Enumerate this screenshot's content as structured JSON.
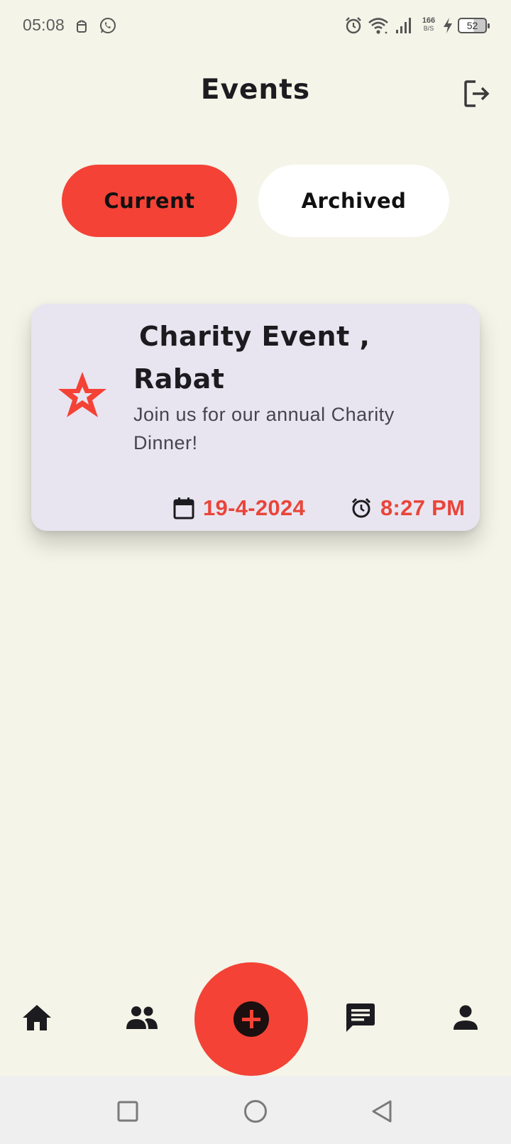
{
  "status_bar": {
    "time": "05:08",
    "net_speed_value": "166",
    "net_speed_unit": "B/S",
    "battery_level": "52",
    "icons": [
      "android-icon",
      "whatsapp-icon",
      "alarm-icon",
      "wifi-icon",
      "signal-icon",
      "charging-icon",
      "battery-icon"
    ]
  },
  "header": {
    "title": "Events",
    "logout_icon": "logout-icon"
  },
  "tabs": [
    {
      "label": "Current",
      "active": true
    },
    {
      "label": "Archived",
      "active": false
    }
  ],
  "events": [
    {
      "title_line1": "Charity Event ,",
      "title_line2": "Rabat",
      "description_line1": "Join us for our annual Charity",
      "description_line2": "Dinner!",
      "date": "19-4-2024",
      "time": "8:27 PM",
      "icon": "star-icon"
    }
  ],
  "bottom_nav": {
    "items": [
      "home-icon",
      "group-icon",
      "add-icon",
      "chat-icon",
      "person-icon"
    ]
  },
  "system_nav": [
    "recents-icon",
    "home-circle-icon",
    "back-icon"
  ],
  "colors": {
    "background": "#f4f4e8",
    "accent": "#f44236",
    "card": "#e8e5f0",
    "accent_text": "#e9453a"
  }
}
